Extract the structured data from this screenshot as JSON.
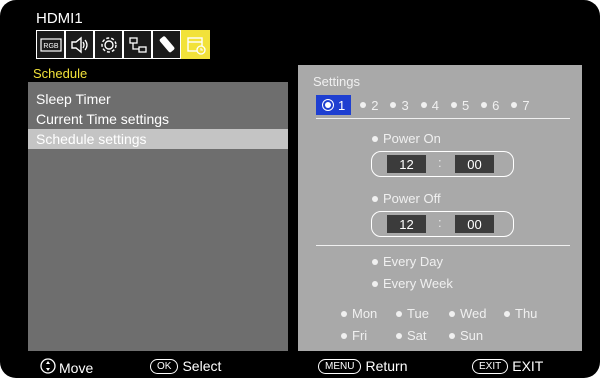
{
  "header": {
    "source": "HDMI1"
  },
  "icons": [
    "rgb-picture-icon",
    "audio-icon",
    "settings-gear-icon",
    "network-icon",
    "remote-control-icon",
    "schedule-calendar-icon"
  ],
  "left": {
    "title": "Schedule",
    "items": [
      "Sleep Timer",
      "Current Time settings",
      "Schedule settings"
    ],
    "selected_index": 2
  },
  "right": {
    "title": "Settings",
    "days": [
      "1",
      "2",
      "3",
      "4",
      "5",
      "6",
      "7"
    ],
    "selected_day": "1",
    "power_on": {
      "label": "Power On",
      "hour": "12",
      "minute": "00",
      "sep": ":"
    },
    "power_off": {
      "label": "Power Off",
      "hour": "12",
      "minute": "00",
      "sep": ":"
    },
    "repeat": [
      "Every Day",
      "Every Week"
    ],
    "weekdays_row1": [
      "Mon",
      "Tue",
      "Wed",
      "Thu"
    ],
    "weekdays_row2": [
      "Fri",
      "Sat",
      "Sun"
    ]
  },
  "footer": {
    "move": "Move",
    "ok_key": "OK",
    "select": "Select",
    "menu_key": "MENU",
    "return": "Return",
    "exit_key": "EXIT",
    "exit": "EXIT"
  },
  "colors": {
    "accent_yellow": "#f2e23a",
    "selected_blue": "#1e3fd1",
    "panel_gray": "#a9a9a9",
    "left_gray": "#6e6e6e"
  }
}
